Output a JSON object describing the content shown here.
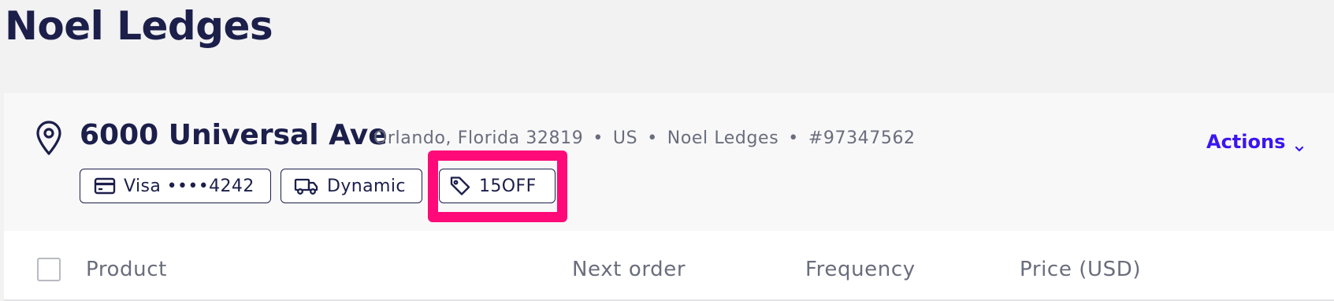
{
  "page": {
    "title": "Noel Ledges"
  },
  "address": {
    "street": "6000 Universal Ave",
    "city_line": "Orlando, Florida 32819",
    "country": "US",
    "name": "Noel Ledges",
    "id": "#97347562",
    "separator": "•"
  },
  "actions": {
    "label": "Actions"
  },
  "chips": {
    "payment": "Visa ••••4242",
    "shipping": "Dynamic",
    "coupon": "15OFF"
  },
  "table": {
    "columns": {
      "product": "Product",
      "next_order": "Next order",
      "frequency": "Frequency",
      "price": "Price (USD)"
    }
  },
  "icons": {
    "location": "map-pin-icon",
    "payment": "credit-card-icon",
    "shipping": "truck-icon",
    "coupon": "tag-icon",
    "dropdown": "chevron-down-icon"
  },
  "colors": {
    "title": "#1c1f4a",
    "accent": "#3b16f0",
    "highlight": "#ff0a78",
    "muted": "#6a6d7c"
  }
}
